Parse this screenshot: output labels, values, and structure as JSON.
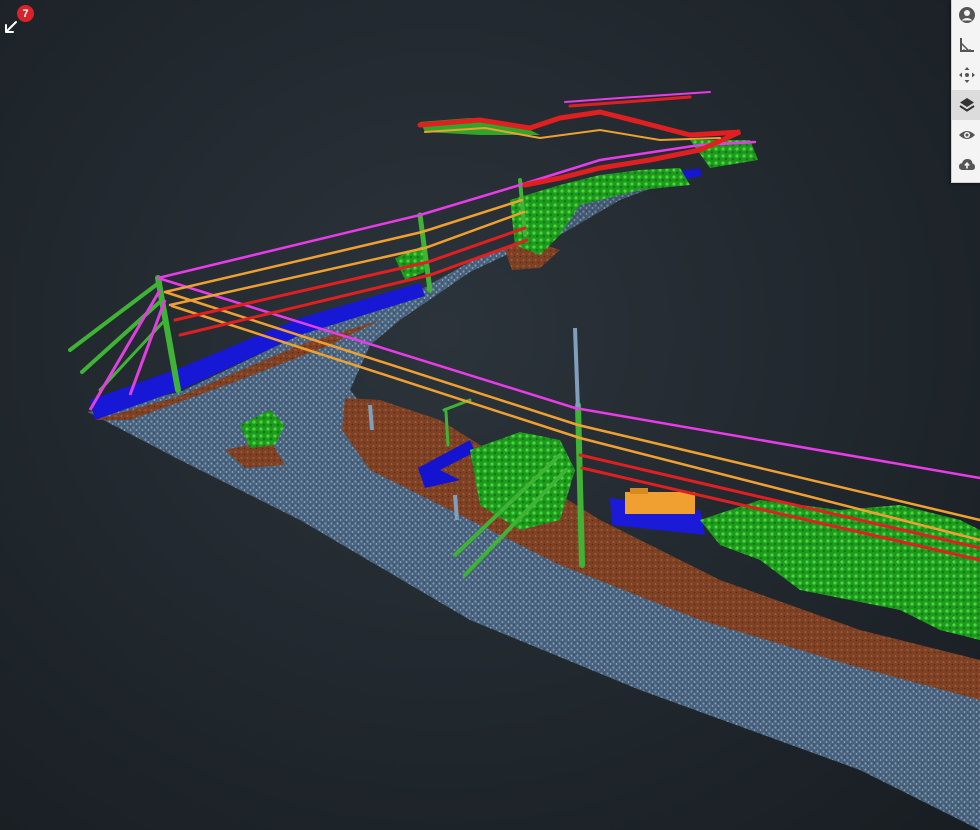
{
  "notification": {
    "count": "7",
    "icon": "pointer-arrow-icon"
  },
  "toolbar": {
    "active": "layers",
    "items": [
      {
        "id": "profile",
        "icon": "user-circle-icon"
      },
      {
        "id": "measure",
        "icon": "ruler-angle-icon"
      },
      {
        "id": "move",
        "icon": "move-arrows-icon"
      },
      {
        "id": "layers",
        "icon": "layers-icon"
      },
      {
        "id": "visibility",
        "icon": "eye-icon"
      },
      {
        "id": "upload",
        "icon": "cloud-upload-icon"
      }
    ]
  },
  "classification_colors": {
    "ground": "#5f7f9c",
    "low_vegetation": "#8a4a2a",
    "vegetation": "#2fb52a",
    "poles_and_guys": "#3fae35",
    "road_barrier": "#1414d8",
    "transformer": "#f0a030",
    "conductor_top": "#e83ce8",
    "conductor_mid": "#f0a030",
    "conductor_low": "#e02020",
    "background": "#20272d"
  }
}
